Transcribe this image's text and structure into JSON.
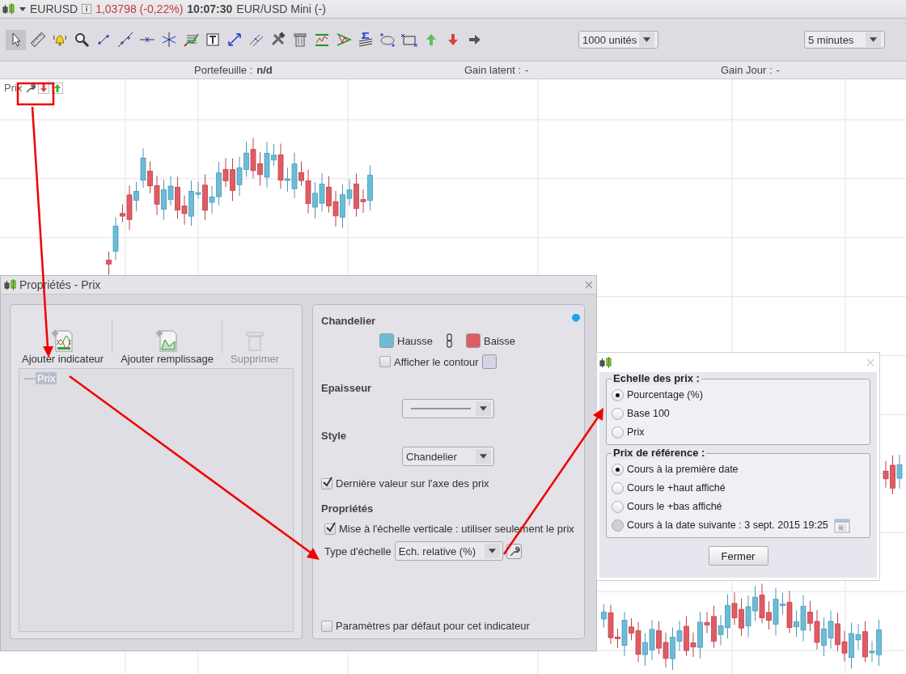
{
  "instrument": {
    "symbol": "EURUSD",
    "price": "1,03798 (-0,22%)",
    "time": "10:07:30",
    "name": "EUR/USD Mini (-)"
  },
  "tools": [
    {
      "kind": "pointer",
      "selected": true
    },
    {
      "kind": "ruler",
      "selected": false
    },
    {
      "kind": "bell",
      "selected": false
    },
    {
      "kind": "search",
      "selected": false
    },
    {
      "kind": "segment",
      "selected": false
    },
    {
      "kind": "line",
      "selected": false
    },
    {
      "kind": "hline",
      "selected": false
    },
    {
      "kind": "vline",
      "selected": false
    },
    {
      "kind": "gridchart",
      "selected": false
    },
    {
      "kind": "text",
      "selected": false
    },
    {
      "kind": "diagarrows",
      "selected": false
    },
    {
      "kind": "parallel",
      "selected": false
    },
    {
      "kind": "tools",
      "selected": false
    },
    {
      "kind": "trash",
      "selected": false
    },
    {
      "kind": "zigzag",
      "selected": false
    },
    {
      "kind": "triangle",
      "selected": false
    },
    {
      "kind": "sigma",
      "selected": false
    },
    {
      "kind": "ellipse",
      "selected": false
    },
    {
      "kind": "rectangle",
      "selected": false
    },
    {
      "kind": "up",
      "selected": false
    },
    {
      "kind": "down",
      "selected": false
    },
    {
      "kind": "right",
      "selected": false
    }
  ],
  "quantity_select": {
    "value": "1000 unités"
  },
  "period_select": {
    "value": "5 minutes"
  },
  "info_bar": [
    {
      "label": "Portefeuille :",
      "value": "n/d"
    },
    {
      "label": "Gain latent :",
      "value": "-"
    },
    {
      "label": "Gain Jour :",
      "value": "-"
    }
  ],
  "chart": {
    "label": "Prix"
  },
  "properties_dialog": {
    "title": "Propriétés - Prix",
    "actions": [
      {
        "label": "Ajouter indicateur",
        "kind": "indicator",
        "disabled": false
      },
      {
        "label": "Ajouter remplissage",
        "kind": "fill",
        "disabled": false
      },
      {
        "label": "Supprimer",
        "kind": "delete",
        "disabled": true
      }
    ],
    "series_list": [
      {
        "label": "Prix",
        "selected": true
      }
    ],
    "candle": {
      "heading": "Chandelier",
      "colors": [
        {
          "label": "Hausse",
          "color": "#6cbcd6"
        },
        {
          "label": "Baisse",
          "color": "#e05c64"
        }
      ],
      "outline": {
        "label": "Afficher le contour",
        "checked": false,
        "color": "#d4d4e6"
      }
    },
    "thickness": {
      "heading": "Epaisseur"
    },
    "style": {
      "heading": "Style",
      "value": "Chandelier"
    },
    "last_value": {
      "label": "Dernière valeur sur l'axe des prix",
      "checked": true
    },
    "properties": {
      "heading": "Propriétés",
      "vertical_scale": {
        "label": "Mise à l'échelle verticale : utiliser seulement le prix",
        "checked": true
      },
      "scale_type": {
        "label": "Type d'échelle",
        "value": "Ech. relative (%)"
      }
    },
    "default_params": {
      "label": "Paramètres par défaut pour cet indicateur",
      "checked": false
    }
  },
  "scale_popup": {
    "groups": [
      {
        "title": "Echelle des prix :",
        "options": [
          {
            "label": "Pourcentage (%)",
            "kind": "plain",
            "selected": true,
            "disabled": false
          },
          {
            "label": "Base 100",
            "kind": "plain",
            "selected": false,
            "disabled": false
          },
          {
            "label": "Prix",
            "kind": "plain",
            "selected": false,
            "disabled": false
          }
        ]
      },
      {
        "title": "Prix de référence :",
        "options": [
          {
            "label": "Cours à la première date",
            "kind": "plain",
            "selected": true,
            "disabled": false
          },
          {
            "label": "Cours le +haut affiché",
            "kind": "plain",
            "selected": false,
            "disabled": false
          },
          {
            "label": "Cours le +bas affiché",
            "kind": "plain",
            "selected": false,
            "disabled": false
          },
          {
            "label": "Cours à la date suivante : 3 sept. 2015 19:25",
            "kind": "date",
            "selected": false,
            "disabled": true
          }
        ]
      }
    ],
    "button": "Fermer"
  }
}
